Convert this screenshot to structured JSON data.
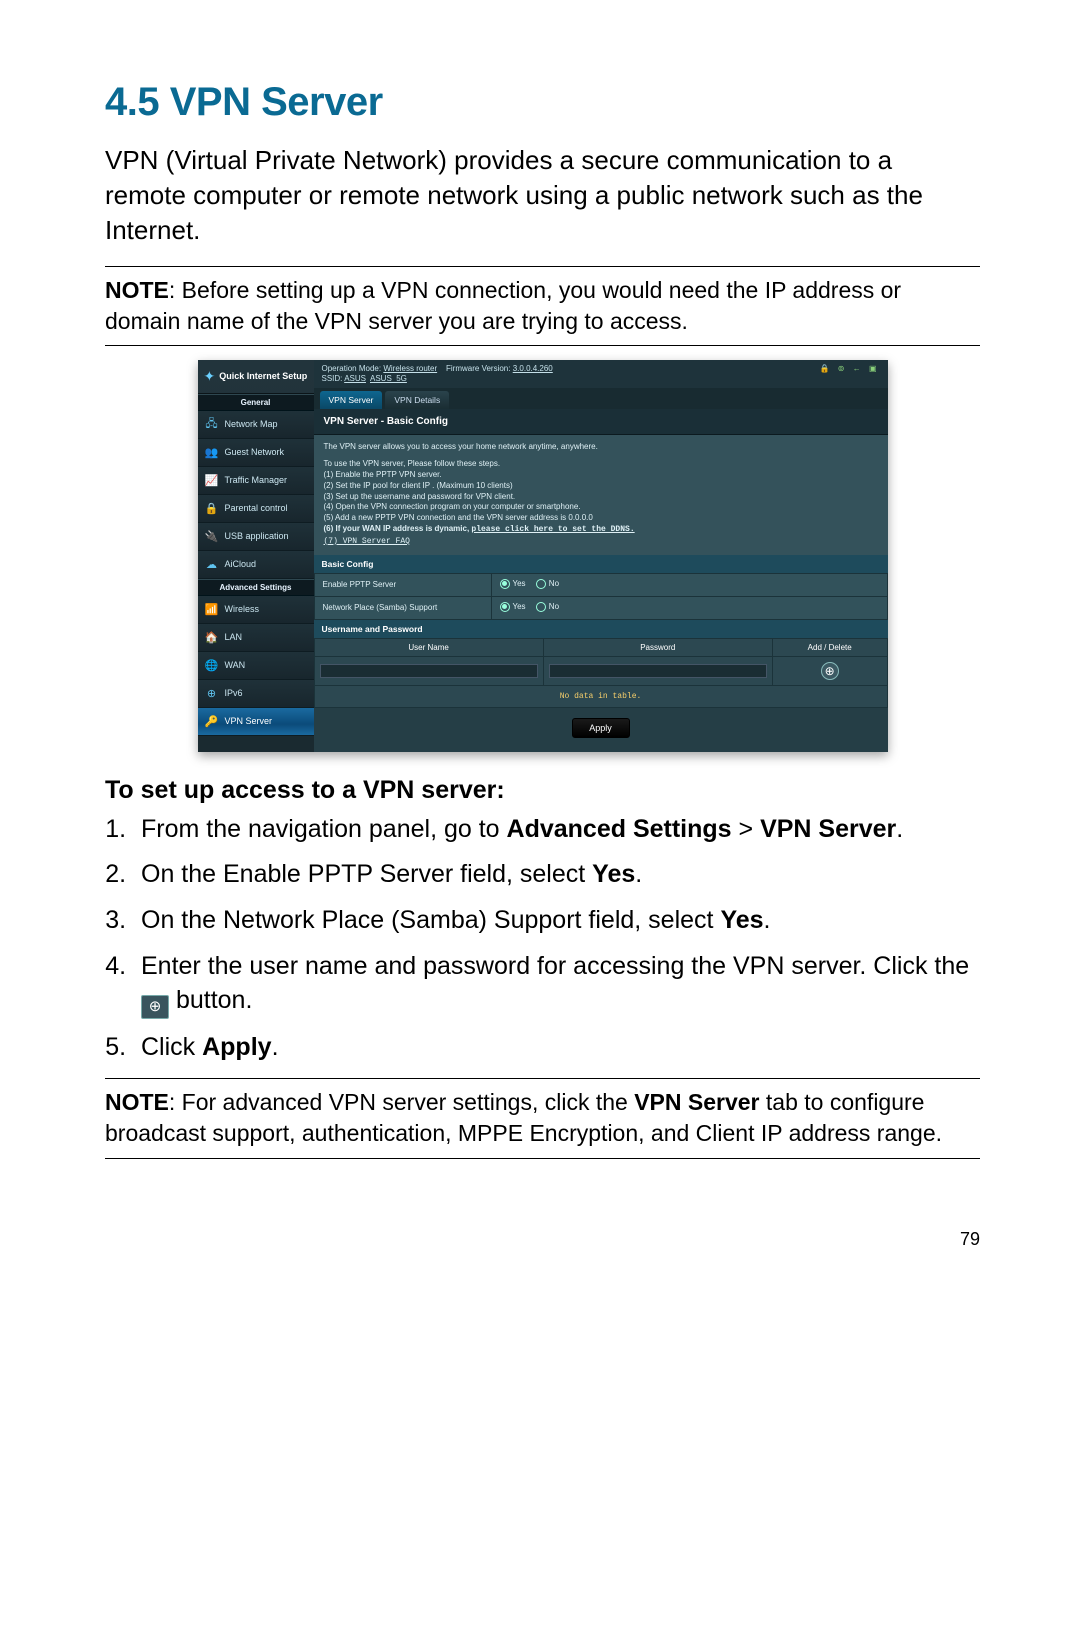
{
  "heading": "4.5   VPN Server",
  "intro": "VPN (Virtual Private Network) provides a secure communication to a remote computer or remote network using a public network such as the Internet.",
  "note_top_label": "NOTE",
  "note_top_body": ":  Before setting up a VPN connection, you would need the IP address or domain name of the VPN server you are trying to access.",
  "router_ui": {
    "qis": "Quick Internet Setup",
    "section_general": "General",
    "section_advanced": "Advanced Settings",
    "nav_general": [
      {
        "icon": "🖧",
        "label": "Network Map"
      },
      {
        "icon": "👥",
        "label": "Guest Network"
      },
      {
        "icon": "📈",
        "label": "Traffic Manager"
      },
      {
        "icon": "🔒",
        "label": "Parental control"
      },
      {
        "icon": "🔌",
        "label": "USB application"
      },
      {
        "icon": "☁",
        "label": "AiCloud"
      }
    ],
    "nav_adv": [
      {
        "icon": "📶",
        "label": "Wireless"
      },
      {
        "icon": "🏠",
        "label": "LAN"
      },
      {
        "icon": "🌐",
        "label": "WAN"
      },
      {
        "icon": "⊕",
        "label": "IPv6"
      },
      {
        "icon": "🔑",
        "label": "VPN Server",
        "active": true
      }
    ],
    "top": {
      "op_label": "Operation Mode:",
      "op_value": "Wireless router",
      "fw_label": "Firmware Version:",
      "fw_value": "3.0.0.4.260",
      "ssid_label": "SSID:",
      "ssid1": "ASUS",
      "ssid2": "ASUS_5G"
    },
    "tabs": {
      "active": "VPN Server",
      "inactive": "VPN Details"
    },
    "panel_title": "VPN Server - Basic Config",
    "desc": "The VPN server allows you to access your home network anytime, anywhere.",
    "steps_lead": "To use the VPN server, Please follow these steps.",
    "steps": [
      "(1) Enable the PPTP VPN server.",
      "(2) Set the IP pool for client IP . (Maximum 10 clients)",
      "(3) Set up the username and password for VPN client.",
      "(4) Open the VPN connection program on your computer or smartphone.",
      "(5) Add a new PPTP VPN connection and the VPN server address is 0.0.0.0"
    ],
    "step6_a": "(6) If your WAN IP address is dynamic, ",
    "step6_b": "please click here to set the DDNS.",
    "step7": "(7) VPN Server FAQ",
    "basic_config_header": "Basic Config",
    "row1_label": "Enable PPTP Server",
    "row2_label": "Network Place (Samba) Support",
    "yes": "Yes",
    "no": "No",
    "up_header": "Username and Password",
    "col_user": "User Name",
    "col_pass": "Password",
    "col_add": "Add / Delete",
    "nodata": "No data in table.",
    "apply": "Apply"
  },
  "setup_subhead": "To set up access to a VPN server:",
  "setup_steps": {
    "s1a": "From the navigation panel, go to ",
    "s1b": "Advanced Settings",
    "s1c": " > ",
    "s1d": "VPN Server",
    "s1e": ".",
    "s2a": "On the Enable PPTP Server field, select ",
    "s2b": "Yes",
    "s2c": ".",
    "s3a": "On the Network Place (Samba) Support field, select ",
    "s3b": "Yes",
    "s3c": ".",
    "s4a": "Enter the user name and password for accessing the VPN server. Click the ",
    "s4b": " button.",
    "s5a": "Click ",
    "s5b": "Apply",
    "s5c": "."
  },
  "note_bottom_label": "NOTE",
  "note_bottom_a": ":  For advanced VPN server settings, click the ",
  "note_bottom_b": "VPN Server",
  "note_bottom_c": " tab to configure broadcast support, authentication, MPPE Encryption, and Client IP address range.",
  "page_number": "79"
}
